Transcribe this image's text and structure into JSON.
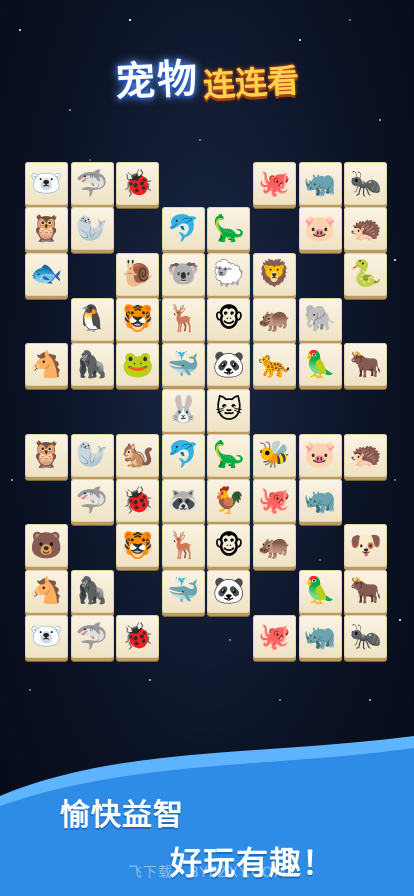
{
  "title": {
    "part1": "宠物",
    "part2": "连连看"
  },
  "slogan": {
    "line1": "愉快益智",
    "line2": "好玩有趣！"
  },
  "watermark": "飞下载 · BYFZXY.COM",
  "colors": {
    "tile_face": "#fbf4e4",
    "tile_edge": "#b89a64",
    "title_blue": "#2b63d9",
    "title_yellow": "#ffd24a",
    "wave_blue": "#2e8be6"
  },
  "tiles": [
    {
      "col": 0,
      "row": 0,
      "animal": "polar-bear",
      "glyph": "🐻‍❄️"
    },
    {
      "col": 1,
      "row": 0,
      "animal": "shark",
      "glyph": "🦈"
    },
    {
      "col": 2,
      "row": 0,
      "animal": "ladybug",
      "glyph": "🐞"
    },
    {
      "col": 5,
      "row": 0,
      "animal": "octopus",
      "glyph": "🐙"
    },
    {
      "col": 6,
      "row": 0,
      "animal": "rhino",
      "glyph": "🦏"
    },
    {
      "col": 7,
      "row": 0,
      "animal": "ant",
      "glyph": "🐜"
    },
    {
      "col": 0,
      "row": 1,
      "animal": "owl",
      "glyph": "🦉"
    },
    {
      "col": 1,
      "row": 1,
      "animal": "seal",
      "glyph": "🦭"
    },
    {
      "col": 3,
      "row": 1,
      "animal": "dolphin",
      "glyph": "🐬"
    },
    {
      "col": 4,
      "row": 1,
      "animal": "dinosaur",
      "glyph": "🦕"
    },
    {
      "col": 6,
      "row": 1,
      "animal": "pig",
      "glyph": "🐷"
    },
    {
      "col": 7,
      "row": 1,
      "animal": "hedgehog",
      "glyph": "🦔"
    },
    {
      "col": 0,
      "row": 2,
      "animal": "fish",
      "glyph": "🐟"
    },
    {
      "col": 2,
      "row": 2,
      "animal": "snail",
      "glyph": "🐌"
    },
    {
      "col": 3,
      "row": 2,
      "animal": "koala",
      "glyph": "🐨"
    },
    {
      "col": 4,
      "row": 2,
      "animal": "sheep",
      "glyph": "🐑"
    },
    {
      "col": 5,
      "row": 2,
      "animal": "lion",
      "glyph": "🦁"
    },
    {
      "col": 7,
      "row": 2,
      "animal": "snake",
      "glyph": "🐍"
    },
    {
      "col": 1,
      "row": 3,
      "animal": "penguin",
      "glyph": "🐧"
    },
    {
      "col": 2,
      "row": 3,
      "animal": "tiger",
      "glyph": "🐯"
    },
    {
      "col": 3,
      "row": 3,
      "animal": "deer",
      "glyph": "🦌"
    },
    {
      "col": 4,
      "row": 3,
      "animal": "monkey",
      "glyph": "🐵"
    },
    {
      "col": 5,
      "row": 3,
      "animal": "hippo",
      "glyph": "🦛"
    },
    {
      "col": 6,
      "row": 3,
      "animal": "elephant",
      "glyph": "🐘"
    },
    {
      "col": 0,
      "row": 4,
      "animal": "horse",
      "glyph": "🐴"
    },
    {
      "col": 1,
      "row": 4,
      "animal": "gorilla",
      "glyph": "🦍"
    },
    {
      "col": 2,
      "row": 4,
      "animal": "frog",
      "glyph": "🐸"
    },
    {
      "col": 3,
      "row": 4,
      "animal": "whale",
      "glyph": "🐳"
    },
    {
      "col": 4,
      "row": 4,
      "animal": "panda",
      "glyph": "🐼"
    },
    {
      "col": 5,
      "row": 4,
      "animal": "leopard",
      "glyph": "🐆"
    },
    {
      "col": 6,
      "row": 4,
      "animal": "parrot",
      "glyph": "🦜"
    },
    {
      "col": 7,
      "row": 4,
      "animal": "ox",
      "glyph": "🐂"
    },
    {
      "col": 3,
      "row": 5,
      "animal": "rabbit",
      "glyph": "🐰"
    },
    {
      "col": 4,
      "row": 5,
      "animal": "cat",
      "glyph": "🐱"
    },
    {
      "col": 0,
      "row": 6,
      "animal": "owl",
      "glyph": "🦉"
    },
    {
      "col": 1,
      "row": 6,
      "animal": "seal",
      "glyph": "🦭"
    },
    {
      "col": 2,
      "row": 6,
      "animal": "squirrel",
      "glyph": "🐿️"
    },
    {
      "col": 3,
      "row": 6,
      "animal": "dolphin",
      "glyph": "🐬"
    },
    {
      "col": 4,
      "row": 6,
      "animal": "dinosaur",
      "glyph": "🦕"
    },
    {
      "col": 5,
      "row": 6,
      "animal": "bee",
      "glyph": "🐝"
    },
    {
      "col": 6,
      "row": 6,
      "animal": "pig",
      "glyph": "🐷"
    },
    {
      "col": 7,
      "row": 6,
      "animal": "hedgehog",
      "glyph": "🦔"
    },
    {
      "col": 1,
      "row": 7,
      "animal": "shark",
      "glyph": "🦈"
    },
    {
      "col": 2,
      "row": 7,
      "animal": "ladybug",
      "glyph": "🐞"
    },
    {
      "col": 3,
      "row": 7,
      "animal": "raccoon",
      "glyph": "🦝"
    },
    {
      "col": 4,
      "row": 7,
      "animal": "rooster",
      "glyph": "🐓"
    },
    {
      "col": 5,
      "row": 7,
      "animal": "octopus",
      "glyph": "🐙"
    },
    {
      "col": 6,
      "row": 7,
      "animal": "rhino",
      "glyph": "🦏"
    },
    {
      "col": 0,
      "row": 8,
      "animal": "bear",
      "glyph": "🐻"
    },
    {
      "col": 2,
      "row": 8,
      "animal": "tiger",
      "glyph": "🐯"
    },
    {
      "col": 3,
      "row": 8,
      "animal": "deer",
      "glyph": "🦌"
    },
    {
      "col": 4,
      "row": 8,
      "animal": "monkey",
      "glyph": "🐵"
    },
    {
      "col": 5,
      "row": 8,
      "animal": "hippo",
      "glyph": "🦛"
    },
    {
      "col": 7,
      "row": 8,
      "animal": "dog",
      "glyph": "🐶"
    },
    {
      "col": 0,
      "row": 9,
      "animal": "horse",
      "glyph": "🐴"
    },
    {
      "col": 1,
      "row": 9,
      "animal": "gorilla",
      "glyph": "🦍"
    },
    {
      "col": 3,
      "row": 9,
      "animal": "whale",
      "glyph": "🐳"
    },
    {
      "col": 4,
      "row": 9,
      "animal": "panda",
      "glyph": "🐼"
    },
    {
      "col": 6,
      "row": 9,
      "animal": "parrot",
      "glyph": "🦜"
    },
    {
      "col": 7,
      "row": 9,
      "animal": "ox",
      "glyph": "🐂"
    },
    {
      "col": 0,
      "row": 10,
      "animal": "polar-bear",
      "glyph": "🐻‍❄️"
    },
    {
      "col": 1,
      "row": 10,
      "animal": "shark",
      "glyph": "🦈"
    },
    {
      "col": 2,
      "row": 10,
      "animal": "ladybug",
      "glyph": "🐞"
    },
    {
      "col": 5,
      "row": 10,
      "animal": "octopus",
      "glyph": "🐙"
    },
    {
      "col": 6,
      "row": 10,
      "animal": "rhino",
      "glyph": "🦏"
    },
    {
      "col": 7,
      "row": 10,
      "animal": "ant",
      "glyph": "🐜"
    }
  ]
}
